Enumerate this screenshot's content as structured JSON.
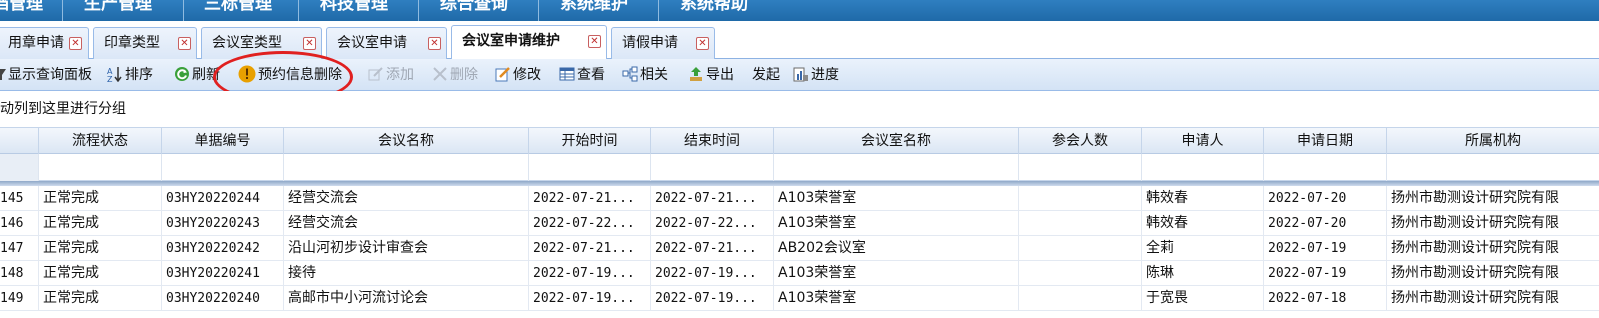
{
  "top_menu": [
    "档管理",
    "生产管理",
    "三标管理",
    "科技管理",
    "综合查询",
    "系统维护",
    "系统帮助"
  ],
  "tabs": [
    {
      "label": "用章申请",
      "active": false
    },
    {
      "label": "印章类型",
      "active": false
    },
    {
      "label": "会议室类型",
      "active": false
    },
    {
      "label": "会议室申请",
      "active": false
    },
    {
      "label": "会议室申请维护",
      "active": true
    },
    {
      "label": "请假申请",
      "active": false
    }
  ],
  "toolbar": {
    "show_query_panel": "显示查询面板",
    "sort": "排序",
    "refresh": "刷新",
    "delete_reservation": "预约信息删除",
    "add": "添加",
    "delete": "删除",
    "modify": "修改",
    "view": "查看",
    "related": "相关",
    "export": "导出",
    "initiate": "发起",
    "progress": "进度"
  },
  "group_hint": "拖动列到这里进行分组",
  "columns": [
    "流程状态",
    "单据编号",
    "会议名称",
    "开始时间",
    "结束时间",
    "会议室名称",
    "参会人数",
    "申请人",
    "申请日期",
    "所属机构"
  ],
  "rows": [
    {
      "num": "145",
      "status": "正常完成",
      "code": "03HY20220244",
      "name": "经营交流会",
      "start": "2022-07-21...",
      "end": "2022-07-21...",
      "room": "A103荣誉室",
      "attendees": "",
      "applicant": "韩效春",
      "date": "2022-07-20",
      "org": "扬州市勘测设计研究院有限"
    },
    {
      "num": "146",
      "status": "正常完成",
      "code": "03HY20220243",
      "name": "经营交流会",
      "start": "2022-07-22...",
      "end": "2022-07-22...",
      "room": "A103荣誉室",
      "attendees": "",
      "applicant": "韩效春",
      "date": "2022-07-20",
      "org": "扬州市勘测设计研究院有限"
    },
    {
      "num": "147",
      "status": "正常完成",
      "code": "03HY20220242",
      "name": "沿山河初步设计审查会",
      "start": "2022-07-21...",
      "end": "2022-07-21...",
      "room": "AB202会议室",
      "attendees": "",
      "applicant": "全莉",
      "date": "2022-07-19",
      "org": "扬州市勘测设计研究院有限"
    },
    {
      "num": "148",
      "status": "正常完成",
      "code": "03HY20220241",
      "name": "接待",
      "start": "2022-07-19...",
      "end": "2022-07-19...",
      "room": "A103荣誉室",
      "attendees": "",
      "applicant": "陈琳",
      "date": "2022-07-19",
      "org": "扬州市勘测设计研究院有限"
    },
    {
      "num": "149",
      "status": "正常完成",
      "code": "03HY20220240",
      "name": "高邮市中小河流讨论会",
      "start": "2022-07-19...",
      "end": "2022-07-19...",
      "room": "A103荣誉室",
      "attendees": "",
      "applicant": "于宽畏",
      "date": "2022-07-18",
      "org": "扬州市勘测设计研究院有限"
    }
  ]
}
